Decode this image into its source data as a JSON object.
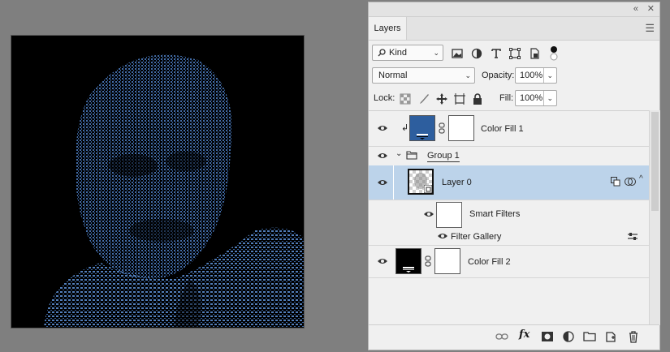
{
  "panel": {
    "tab_label": "Layers",
    "collapse_icon": "double-chevron-left-icon",
    "close_icon": "close-icon",
    "menu_icon": "hamburger-menu-icon"
  },
  "filter": {
    "kind_label": "Kind",
    "blend_mode": "Normal",
    "opacity_label": "Opacity:",
    "opacity_value": "100%",
    "lock_label": "Lock:",
    "fill_label": "Fill:",
    "fill_value": "100%"
  },
  "layers": {
    "color_fill_1": {
      "name": "Color Fill 1",
      "fill_color": "#2d5e9e"
    },
    "group_1": {
      "name": "Group 1"
    },
    "layer_0": {
      "name": "Layer 0"
    },
    "smart_filters": {
      "name": "Smart Filters"
    },
    "filter_gallery": {
      "name": "Filter Gallery"
    },
    "color_fill_2": {
      "name": "Color Fill 2",
      "fill_color": "#000000"
    }
  },
  "colors": {
    "selection": "#bcd3ea",
    "halftone_blue": "#4a78b8"
  }
}
